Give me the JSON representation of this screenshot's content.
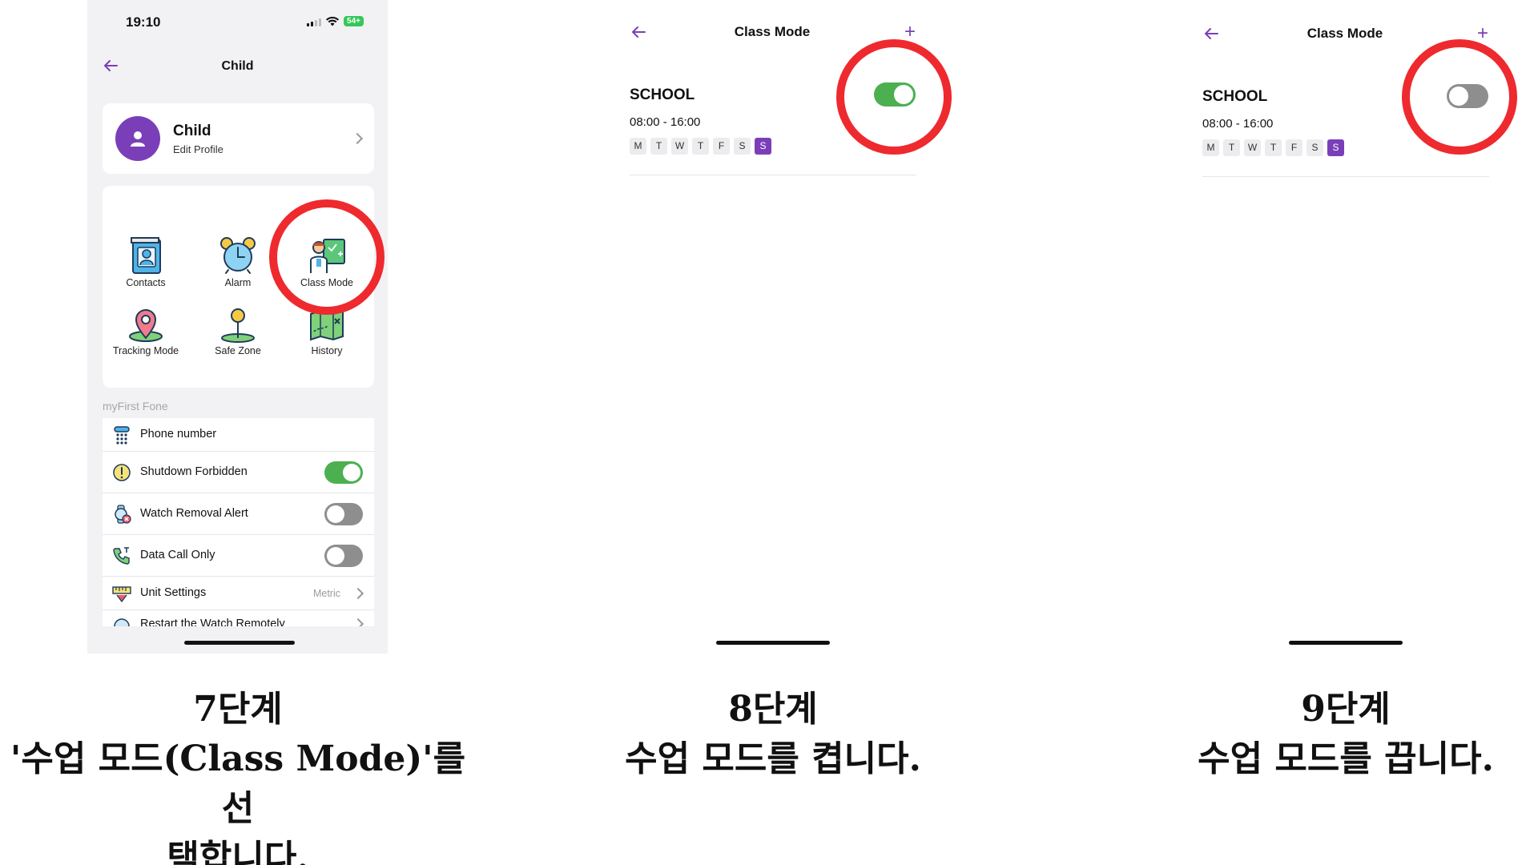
{
  "panel1": {
    "status_time": "19:10",
    "battery": "54+",
    "title": "Child",
    "profile": {
      "name": "Child",
      "subtitle": "Edit Profile"
    },
    "features": [
      {
        "label": "Contacts",
        "icon": "contacts-icon"
      },
      {
        "label": "Alarm",
        "icon": "alarm-icon"
      },
      {
        "label": "Class Mode",
        "icon": "class-mode-icon"
      },
      {
        "label": "Tracking Mode",
        "icon": "tracking-mode-icon"
      },
      {
        "label": "Safe Zone",
        "icon": "safe-zone-icon"
      },
      {
        "label": "History",
        "icon": "history-icon"
      }
    ],
    "section_label": "myFirst Fone",
    "settings": [
      {
        "label": "Phone number",
        "icon": "phone-keypad-icon"
      },
      {
        "label": "Shutdown Forbidden",
        "icon": "warning-icon",
        "toggle": "on"
      },
      {
        "label": "Watch Removal Alert",
        "icon": "watch-alert-icon",
        "toggle": "off"
      },
      {
        "label": "Data Call Only",
        "icon": "phone-call-icon",
        "toggle": "off"
      },
      {
        "label": "Unit Settings",
        "icon": "ruler-icon",
        "value": "Metric"
      },
      {
        "label": "Restart the Watch Remotely",
        "icon": "restart-icon"
      }
    ]
  },
  "panel2": {
    "title": "Class Mode",
    "schedule": {
      "name": "SCHOOL",
      "time": "08:00 - 16:00",
      "days": [
        "M",
        "T",
        "W",
        "T",
        "F",
        "S",
        "S"
      ],
      "selected_day_index": 6,
      "enabled": true
    }
  },
  "panel3": {
    "title": "Class Mode",
    "schedule": {
      "name": "SCHOOL",
      "time": "08:00 - 16:00",
      "days": [
        "M",
        "T",
        "W",
        "T",
        "F",
        "S",
        "S"
      ],
      "selected_day_index": 6,
      "enabled": false
    }
  },
  "captions": [
    {
      "step": "7단계",
      "lines": [
        "'수업 모드(Class Mode)'를 선",
        "택합니다."
      ]
    },
    {
      "step": "8단계",
      "lines": [
        "수업 모드를 켭니다."
      ]
    },
    {
      "step": "9단계",
      "lines": [
        "수업 모드를 끕니다."
      ]
    }
  ],
  "colors": {
    "accent_purple": "#7a3fb8",
    "toggle_on": "#4caf50",
    "toggle_off": "#8e8e8e",
    "highlight_red": "#ee2a2f"
  }
}
